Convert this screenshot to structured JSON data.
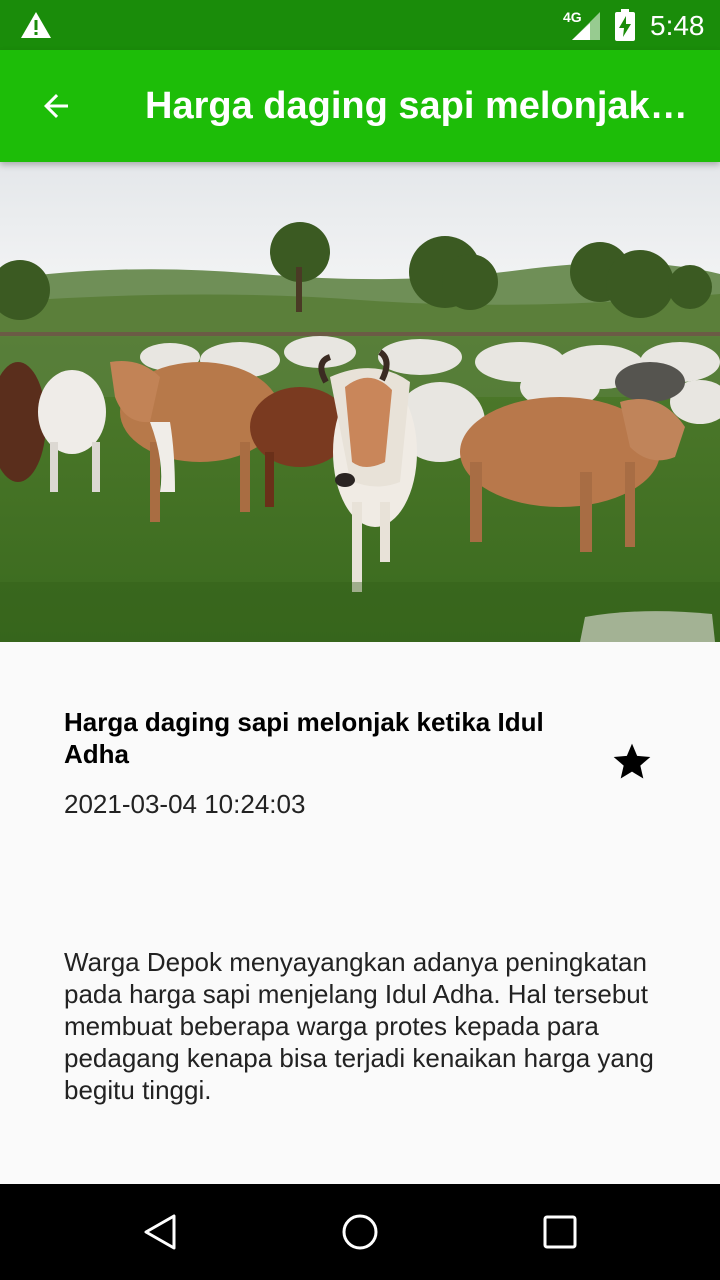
{
  "status_bar": {
    "time": "5:48",
    "network": "4G",
    "warning_icon": "warning-icon",
    "signal_icon": "signal-icon",
    "battery_icon": "battery-charging-icon"
  },
  "app_bar": {
    "title": "Harga daging sapi melonjak ketika Idul Adha",
    "back_icon": "arrow-back-icon",
    "color": "#1dbd08"
  },
  "hero_image": {
    "icon": "cattle-photo"
  },
  "article": {
    "title": "Harga daging sapi melonjak ketika Idul Adha",
    "date": "2021-03-04 10:24:03",
    "body": "Warga Depok menyayangkan adanya peningkatan pada harga sapi menjelang Idul Adha. Hal tersebut membuat beberapa warga protes kepada para pedagang kenapa bisa terjadi kenaikan harga yang begitu tinggi.",
    "favorite_icon": "star-icon"
  },
  "nav_bar": {
    "back_icon": "nav-back-icon",
    "home_icon": "nav-home-icon",
    "recents_icon": "nav-recents-icon"
  }
}
